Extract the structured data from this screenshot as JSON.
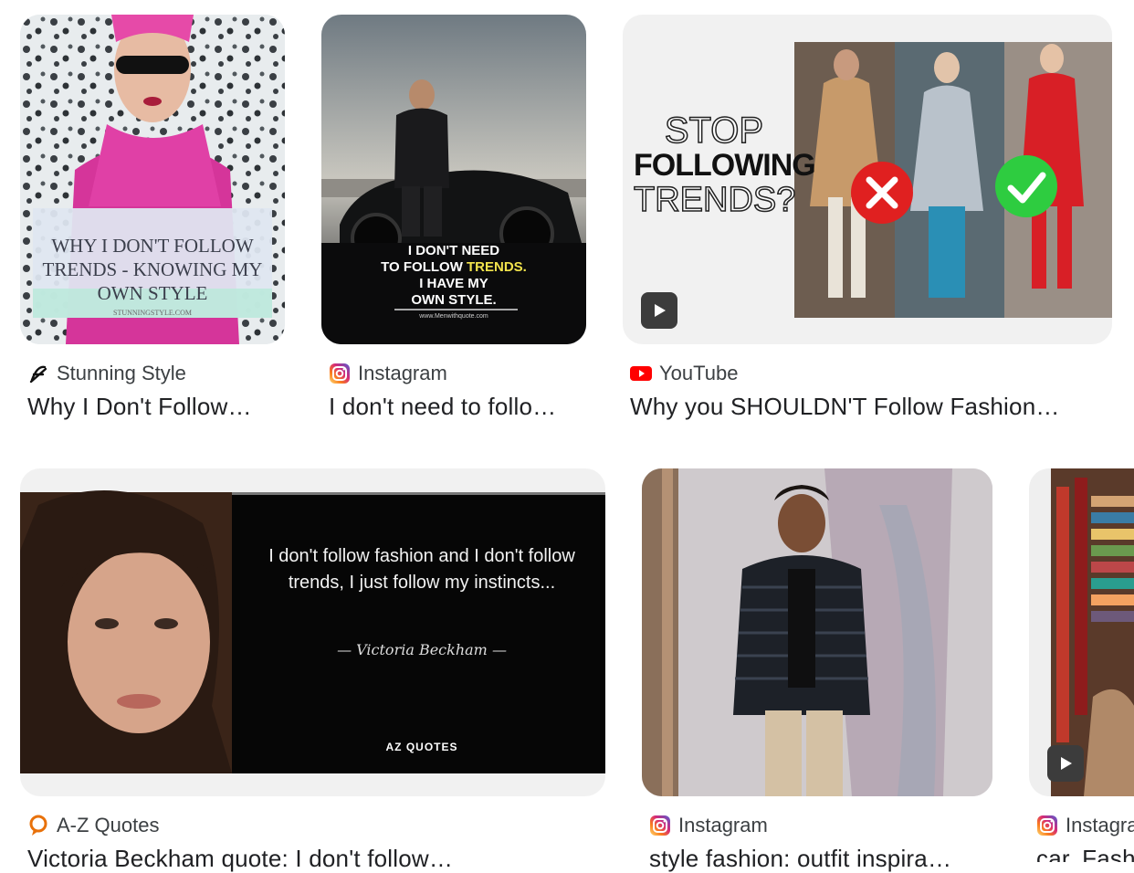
{
  "results": [
    {
      "source": "Stunning Style",
      "source_icon": "stunning-style-logo-icon",
      "title": "Why I Don't Follow…",
      "image_text": {
        "headline": "WHY I DON'T FOLLOW TRENDS - KNOWING MY OWN STYLE",
        "site": "STUNNINGSTYLE.COM"
      }
    },
    {
      "source": "Instagram",
      "source_icon": "instagram-icon",
      "title": "I don't need to follo…",
      "image_text": {
        "line1": "I DON'T NEED",
        "line2a": "TO FOLLOW ",
        "line2b": "TRENDS.",
        "line3": "I HAVE MY",
        "line4": "OWN STYLE.",
        "site": "www.Menwithquote.com"
      }
    },
    {
      "source": "YouTube",
      "source_icon": "youtube-icon",
      "title": "Why you SHOULDN'T Follow Fashion…",
      "image_text": {
        "l1": "STOP",
        "l2": "FOLLOWING",
        "l3": "TRENDS?"
      }
    },
    {
      "source": "A-Z Quotes",
      "source_icon": "az-quotes-icon",
      "title": "Victoria Beckham quote: I don't follow…",
      "image_text": {
        "quote": "I don't follow fashion and I don't follow trends, I just follow my instincts...",
        "author": "— Victoria Beckham —",
        "brand": "AZ QUOTES"
      }
    },
    {
      "source": "Instagram",
      "source_icon": "instagram-icon",
      "title": "style fashion: outfit inspira…"
    },
    {
      "source": "Instagram",
      "source_icon": "instagram-icon",
      "title": "car. Fashion…"
    }
  ],
  "colors": {
    "instagram_gradient": [
      "#feda75",
      "#fa7e1e",
      "#d62976",
      "#962fbf",
      "#4f5bd5"
    ],
    "youtube_red": "#ff0000",
    "az_quotes_orange": "#e8710a",
    "trend_yellow": "#f2e34c",
    "check_green": "#2ecc40",
    "cross_red": "#e02020"
  }
}
